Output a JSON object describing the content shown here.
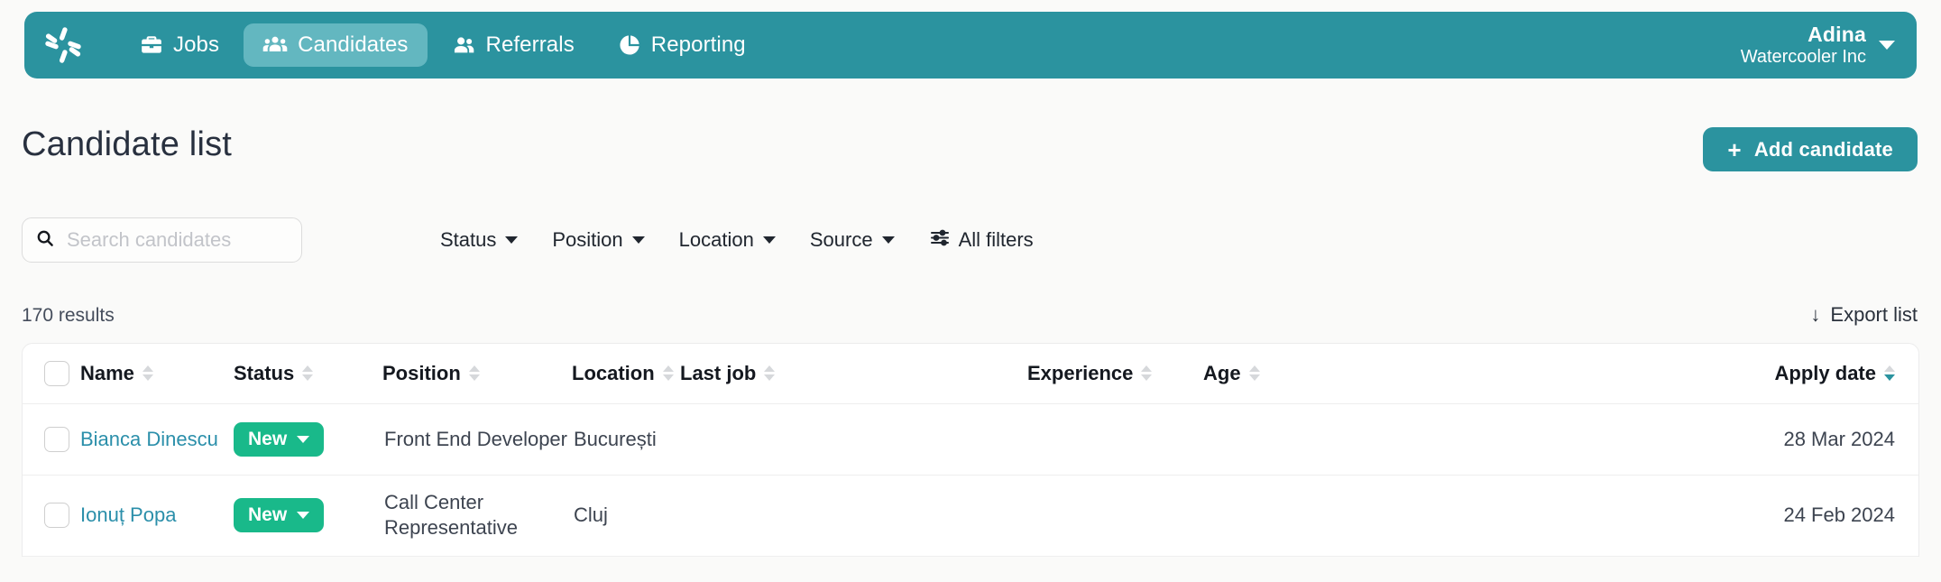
{
  "brand": {
    "logo_icon": "pinwheel-logo",
    "color": "#2b939f"
  },
  "nav": {
    "items": [
      {
        "label": "Jobs",
        "icon": "briefcase-icon",
        "active": false
      },
      {
        "label": "Candidates",
        "icon": "people-group-icon",
        "active": true
      },
      {
        "label": "Referrals",
        "icon": "two-people-icon",
        "active": false
      },
      {
        "label": "Reporting",
        "icon": "pie-chart-icon",
        "active": false
      }
    ],
    "user": {
      "name": "Adina",
      "org": "Watercooler Inc",
      "caret_icon": "chevron-down-icon"
    }
  },
  "page": {
    "title": "Candidate list",
    "add_button": {
      "label": "Add candidate",
      "icon": "plus-icon"
    }
  },
  "search": {
    "placeholder": "Search candidates",
    "value": "",
    "icon": "search-icon"
  },
  "filters": [
    {
      "label": "Status",
      "icon": "chevron-down-icon"
    },
    {
      "label": "Position",
      "icon": "chevron-down-icon"
    },
    {
      "label": "Location",
      "icon": "chevron-down-icon"
    },
    {
      "label": "Source",
      "icon": "chevron-down-icon"
    }
  ],
  "all_filters": {
    "label": "All filters",
    "icon": "sliders-icon"
  },
  "results": {
    "count_label": "170 results"
  },
  "export": {
    "label": "Export list",
    "icon": "download-arrow-icon"
  },
  "table": {
    "columns": [
      {
        "label": "Name",
        "sort": "none"
      },
      {
        "label": "Status",
        "sort": "none"
      },
      {
        "label": "Position",
        "sort": "none"
      },
      {
        "label": "Location",
        "sort": "none"
      },
      {
        "label": "Last job",
        "sort": "none"
      },
      {
        "label": "Experience",
        "sort": "none"
      },
      {
        "label": "Age",
        "sort": "none"
      },
      {
        "label": "Apply date",
        "sort": "desc"
      }
    ],
    "rows": [
      {
        "name": "Bianca Dinescu",
        "status": "New",
        "position": "Front End Developer",
        "location": "București",
        "last_job": "",
        "experience": "",
        "age": "",
        "apply_date": "28 Mar 2024"
      },
      {
        "name": "Ionuț Popa",
        "status": "New",
        "position": "Call Center Representative",
        "location": "Cluj",
        "last_job": "",
        "experience": "",
        "age": "",
        "apply_date": "24 Feb 2024"
      }
    ]
  },
  "colors": {
    "teal": "#2b939f",
    "teal_light": "#63b7c0",
    "badge_green": "#19b98a",
    "link": "#2b8faa"
  }
}
